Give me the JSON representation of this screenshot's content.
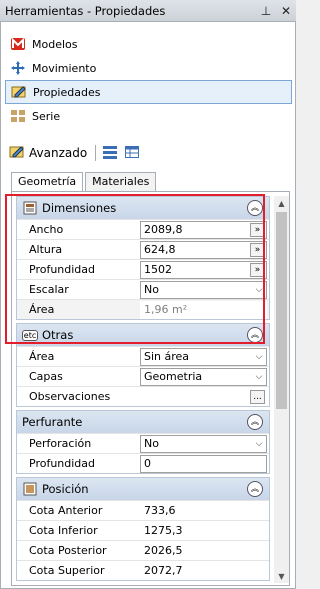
{
  "window": {
    "title": "Herramientas - Propiedades",
    "pin_glyph": "⊥",
    "close_glyph": "✕"
  },
  "nav": {
    "items": [
      {
        "label": "Modelos",
        "icon": "models-icon"
      },
      {
        "label": "Movimiento",
        "icon": "move-icon"
      },
      {
        "label": "Propiedades",
        "icon": "properties-icon",
        "selected": true
      },
      {
        "label": "Serie",
        "icon": "series-icon"
      }
    ]
  },
  "toolbar": {
    "mode_label": "Avanzado"
  },
  "tabs": [
    "Geometría",
    "Materiales"
  ],
  "groups": {
    "dimensiones": {
      "title": "Dimensiones",
      "rows": [
        {
          "name": "Ancho",
          "value": "2089,8"
        },
        {
          "name": "Altura",
          "value": "624,8"
        },
        {
          "name": "Profundidad",
          "value": "1502"
        },
        {
          "name": "Escalar",
          "value": "No"
        },
        {
          "name": "Área",
          "value": "1,96 m²"
        }
      ]
    },
    "otras": {
      "title": "Otras",
      "icon_text": "etc",
      "rows": [
        {
          "name": "Área",
          "value": "Sin área"
        },
        {
          "name": "Capas",
          "value": "Geometria"
        },
        {
          "name": "Observaciones",
          "value": ""
        }
      ]
    },
    "perfurante": {
      "title": "Perfurante",
      "rows": [
        {
          "name": "Perforación",
          "value": "No"
        },
        {
          "name": "Profundidad",
          "value": "0"
        }
      ]
    },
    "posicion": {
      "title": "Posición",
      "rows": [
        {
          "name": "Cota Anterior",
          "value": "733,6"
        },
        {
          "name": "Cota Inferior",
          "value": "1275,3"
        },
        {
          "name": "Cota Posterior",
          "value": "2026,5"
        },
        {
          "name": "Cota Superior",
          "value": "2072,7"
        }
      ]
    }
  },
  "glyphs": {
    "more": "»",
    "dropdown": "⌵",
    "ellipsis": "...",
    "collapse": "︽"
  },
  "colors": {
    "highlight": "#e31d2b",
    "group_header": "#c8d6e8",
    "selected_border": "#7aa7d8"
  }
}
